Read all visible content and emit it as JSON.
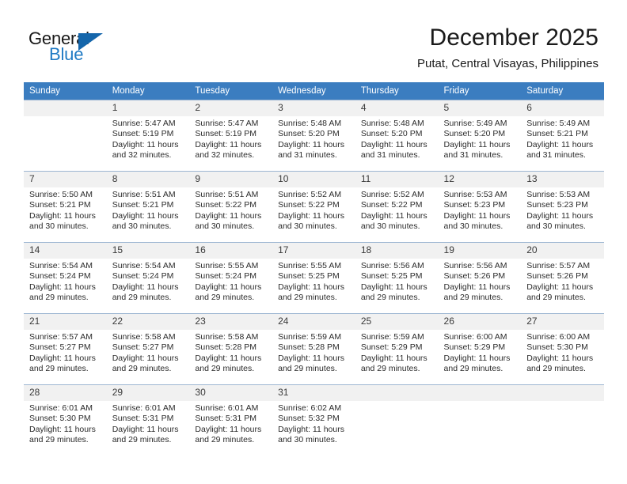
{
  "brand": {
    "name_part1": "General",
    "name_part2": "Blue",
    "accent_color": "#1f7ac4",
    "triangle_color": "#1566ab"
  },
  "header": {
    "month_title": "December 2025",
    "location": "Putat, Central Visayas, Philippines"
  },
  "calendar": {
    "header_bg": "#3b7dc0",
    "weekday_headers": [
      "Sunday",
      "Monday",
      "Tuesday",
      "Wednesday",
      "Thursday",
      "Friday",
      "Saturday"
    ],
    "weeks": [
      [
        {
          "day": "",
          "sunrise": "",
          "sunset": "",
          "daylight1": "",
          "daylight2": ""
        },
        {
          "day": "1",
          "sunrise": "Sunrise: 5:47 AM",
          "sunset": "Sunset: 5:19 PM",
          "daylight1": "Daylight: 11 hours",
          "daylight2": "and 32 minutes."
        },
        {
          "day": "2",
          "sunrise": "Sunrise: 5:47 AM",
          "sunset": "Sunset: 5:19 PM",
          "daylight1": "Daylight: 11 hours",
          "daylight2": "and 32 minutes."
        },
        {
          "day": "3",
          "sunrise": "Sunrise: 5:48 AM",
          "sunset": "Sunset: 5:20 PM",
          "daylight1": "Daylight: 11 hours",
          "daylight2": "and 31 minutes."
        },
        {
          "day": "4",
          "sunrise": "Sunrise: 5:48 AM",
          "sunset": "Sunset: 5:20 PM",
          "daylight1": "Daylight: 11 hours",
          "daylight2": "and 31 minutes."
        },
        {
          "day": "5",
          "sunrise": "Sunrise: 5:49 AM",
          "sunset": "Sunset: 5:20 PM",
          "daylight1": "Daylight: 11 hours",
          "daylight2": "and 31 minutes."
        },
        {
          "day": "6",
          "sunrise": "Sunrise: 5:49 AM",
          "sunset": "Sunset: 5:21 PM",
          "daylight1": "Daylight: 11 hours",
          "daylight2": "and 31 minutes."
        }
      ],
      [
        {
          "day": "7",
          "sunrise": "Sunrise: 5:50 AM",
          "sunset": "Sunset: 5:21 PM",
          "daylight1": "Daylight: 11 hours",
          "daylight2": "and 30 minutes."
        },
        {
          "day": "8",
          "sunrise": "Sunrise: 5:51 AM",
          "sunset": "Sunset: 5:21 PM",
          "daylight1": "Daylight: 11 hours",
          "daylight2": "and 30 minutes."
        },
        {
          "day": "9",
          "sunrise": "Sunrise: 5:51 AM",
          "sunset": "Sunset: 5:22 PM",
          "daylight1": "Daylight: 11 hours",
          "daylight2": "and 30 minutes."
        },
        {
          "day": "10",
          "sunrise": "Sunrise: 5:52 AM",
          "sunset": "Sunset: 5:22 PM",
          "daylight1": "Daylight: 11 hours",
          "daylight2": "and 30 minutes."
        },
        {
          "day": "11",
          "sunrise": "Sunrise: 5:52 AM",
          "sunset": "Sunset: 5:22 PM",
          "daylight1": "Daylight: 11 hours",
          "daylight2": "and 30 minutes."
        },
        {
          "day": "12",
          "sunrise": "Sunrise: 5:53 AM",
          "sunset": "Sunset: 5:23 PM",
          "daylight1": "Daylight: 11 hours",
          "daylight2": "and 30 minutes."
        },
        {
          "day": "13",
          "sunrise": "Sunrise: 5:53 AM",
          "sunset": "Sunset: 5:23 PM",
          "daylight1": "Daylight: 11 hours",
          "daylight2": "and 30 minutes."
        }
      ],
      [
        {
          "day": "14",
          "sunrise": "Sunrise: 5:54 AM",
          "sunset": "Sunset: 5:24 PM",
          "daylight1": "Daylight: 11 hours",
          "daylight2": "and 29 minutes."
        },
        {
          "day": "15",
          "sunrise": "Sunrise: 5:54 AM",
          "sunset": "Sunset: 5:24 PM",
          "daylight1": "Daylight: 11 hours",
          "daylight2": "and 29 minutes."
        },
        {
          "day": "16",
          "sunrise": "Sunrise: 5:55 AM",
          "sunset": "Sunset: 5:24 PM",
          "daylight1": "Daylight: 11 hours",
          "daylight2": "and 29 minutes."
        },
        {
          "day": "17",
          "sunrise": "Sunrise: 5:55 AM",
          "sunset": "Sunset: 5:25 PM",
          "daylight1": "Daylight: 11 hours",
          "daylight2": "and 29 minutes."
        },
        {
          "day": "18",
          "sunrise": "Sunrise: 5:56 AM",
          "sunset": "Sunset: 5:25 PM",
          "daylight1": "Daylight: 11 hours",
          "daylight2": "and 29 minutes."
        },
        {
          "day": "19",
          "sunrise": "Sunrise: 5:56 AM",
          "sunset": "Sunset: 5:26 PM",
          "daylight1": "Daylight: 11 hours",
          "daylight2": "and 29 minutes."
        },
        {
          "day": "20",
          "sunrise": "Sunrise: 5:57 AM",
          "sunset": "Sunset: 5:26 PM",
          "daylight1": "Daylight: 11 hours",
          "daylight2": "and 29 minutes."
        }
      ],
      [
        {
          "day": "21",
          "sunrise": "Sunrise: 5:57 AM",
          "sunset": "Sunset: 5:27 PM",
          "daylight1": "Daylight: 11 hours",
          "daylight2": "and 29 minutes."
        },
        {
          "day": "22",
          "sunrise": "Sunrise: 5:58 AM",
          "sunset": "Sunset: 5:27 PM",
          "daylight1": "Daylight: 11 hours",
          "daylight2": "and 29 minutes."
        },
        {
          "day": "23",
          "sunrise": "Sunrise: 5:58 AM",
          "sunset": "Sunset: 5:28 PM",
          "daylight1": "Daylight: 11 hours",
          "daylight2": "and 29 minutes."
        },
        {
          "day": "24",
          "sunrise": "Sunrise: 5:59 AM",
          "sunset": "Sunset: 5:28 PM",
          "daylight1": "Daylight: 11 hours",
          "daylight2": "and 29 minutes."
        },
        {
          "day": "25",
          "sunrise": "Sunrise: 5:59 AM",
          "sunset": "Sunset: 5:29 PM",
          "daylight1": "Daylight: 11 hours",
          "daylight2": "and 29 minutes."
        },
        {
          "day": "26",
          "sunrise": "Sunrise: 6:00 AM",
          "sunset": "Sunset: 5:29 PM",
          "daylight1": "Daylight: 11 hours",
          "daylight2": "and 29 minutes."
        },
        {
          "day": "27",
          "sunrise": "Sunrise: 6:00 AM",
          "sunset": "Sunset: 5:30 PM",
          "daylight1": "Daylight: 11 hours",
          "daylight2": "and 29 minutes."
        }
      ],
      [
        {
          "day": "28",
          "sunrise": "Sunrise: 6:01 AM",
          "sunset": "Sunset: 5:30 PM",
          "daylight1": "Daylight: 11 hours",
          "daylight2": "and 29 minutes."
        },
        {
          "day": "29",
          "sunrise": "Sunrise: 6:01 AM",
          "sunset": "Sunset: 5:31 PM",
          "daylight1": "Daylight: 11 hours",
          "daylight2": "and 29 minutes."
        },
        {
          "day": "30",
          "sunrise": "Sunrise: 6:01 AM",
          "sunset": "Sunset: 5:31 PM",
          "daylight1": "Daylight: 11 hours",
          "daylight2": "and 29 minutes."
        },
        {
          "day": "31",
          "sunrise": "Sunrise: 6:02 AM",
          "sunset": "Sunset: 5:32 PM",
          "daylight1": "Daylight: 11 hours",
          "daylight2": "and 30 minutes."
        },
        {
          "day": "",
          "sunrise": "",
          "sunset": "",
          "daylight1": "",
          "daylight2": ""
        },
        {
          "day": "",
          "sunrise": "",
          "sunset": "",
          "daylight1": "",
          "daylight2": ""
        },
        {
          "day": "",
          "sunrise": "",
          "sunset": "",
          "daylight1": "",
          "daylight2": ""
        }
      ]
    ]
  }
}
